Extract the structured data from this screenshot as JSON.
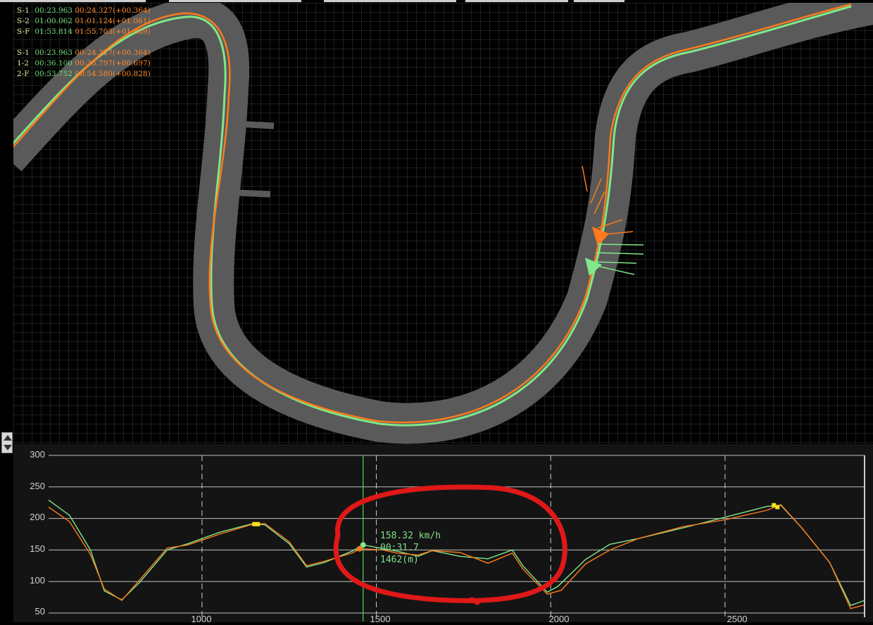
{
  "sector_times_total": [
    {
      "label": "S-1",
      "best": "00:23.963",
      "current": "00:24.327(+00.364)"
    },
    {
      "label": "S-2",
      "best": "01:00.062",
      "current": "01:01.124(+01.061)"
    },
    {
      "label": "S-F",
      "best": "01:53.814",
      "current": "01:55.703(+01.889)"
    }
  ],
  "sector_times_split": [
    {
      "label": "S-1",
      "best": "00:23.963",
      "current": "00:24.327(+00.364)"
    },
    {
      "label": "1-2",
      "best": "00:36.100",
      "current": "00:36.797(+00.697)"
    },
    {
      "label": "2-F",
      "best": "00:53.752",
      "current": "00:54.580(+00.828)"
    }
  ],
  "cursor_readout": {
    "speed": "158.32 km/h",
    "time": "00:31.7",
    "distance": "1462(m)"
  },
  "colors": {
    "best_lap": "#7fe88a",
    "current_lap": "#ff7a1a",
    "track": "#5a5a5a",
    "annotation": "#e01818",
    "background": "#000000"
  },
  "chart_data": {
    "type": "line",
    "title": "",
    "xlabel": "",
    "ylabel": "",
    "xlim": [
      560,
      2900
    ],
    "ylim": [
      50,
      300
    ],
    "x_ticks": [
      "1000",
      "1500",
      "2000",
      "2500"
    ],
    "y_ticks": [
      "300",
      "250",
      "200",
      "150",
      "100",
      "50"
    ],
    "cursor_x": 1462,
    "series": [
      {
        "color": "#7fe88a",
        "points": [
          [
            560,
            229
          ],
          [
            620,
            205
          ],
          [
            680,
            150
          ],
          [
            720,
            85
          ],
          [
            770,
            71
          ],
          [
            820,
            98
          ],
          [
            900,
            150
          ],
          [
            960,
            160
          ],
          [
            1050,
            178
          ],
          [
            1140,
            191
          ],
          [
            1180,
            190
          ],
          [
            1250,
            160
          ],
          [
            1300,
            123
          ],
          [
            1350,
            130
          ],
          [
            1430,
            148
          ],
          [
            1462,
            158
          ],
          [
            1520,
            152
          ],
          [
            1560,
            148
          ],
          [
            1620,
            140
          ],
          [
            1660,
            149
          ],
          [
            1740,
            140
          ],
          [
            1820,
            136
          ],
          [
            1890,
            150
          ],
          [
            1920,
            125
          ],
          [
            1990,
            83
          ],
          [
            2020,
            92
          ],
          [
            2100,
            135
          ],
          [
            2170,
            159
          ],
          [
            2250,
            168
          ],
          [
            2380,
            185
          ],
          [
            2500,
            202
          ],
          [
            2620,
            219
          ],
          [
            2660,
            221
          ],
          [
            2720,
            185
          ],
          [
            2800,
            130
          ],
          [
            2860,
            62
          ],
          [
            2900,
            70
          ]
        ]
      },
      {
        "color": "#ff7a1a",
        "points": [
          [
            560,
            218
          ],
          [
            620,
            195
          ],
          [
            680,
            143
          ],
          [
            720,
            88
          ],
          [
            770,
            70
          ],
          [
            820,
            102
          ],
          [
            900,
            153
          ],
          [
            960,
            158
          ],
          [
            1050,
            175
          ],
          [
            1140,
            190
          ],
          [
            1180,
            192
          ],
          [
            1250,
            163
          ],
          [
            1300,
            125
          ],
          [
            1350,
            132
          ],
          [
            1430,
            145
          ],
          [
            1455,
            152
          ],
          [
            1520,
            150
          ],
          [
            1560,
            145
          ],
          [
            1620,
            142
          ],
          [
            1660,
            149
          ],
          [
            1740,
            146
          ],
          [
            1820,
            129
          ],
          [
            1890,
            145
          ],
          [
            1920,
            120
          ],
          [
            1990,
            80
          ],
          [
            2030,
            86
          ],
          [
            2100,
            128
          ],
          [
            2170,
            150
          ],
          [
            2250,
            168
          ],
          [
            2380,
            187
          ],
          [
            2500,
            198
          ],
          [
            2620,
            213
          ],
          [
            2660,
            222
          ],
          [
            2720,
            185
          ],
          [
            2800,
            130
          ],
          [
            2860,
            57
          ],
          [
            2900,
            63
          ]
        ]
      }
    ]
  }
}
